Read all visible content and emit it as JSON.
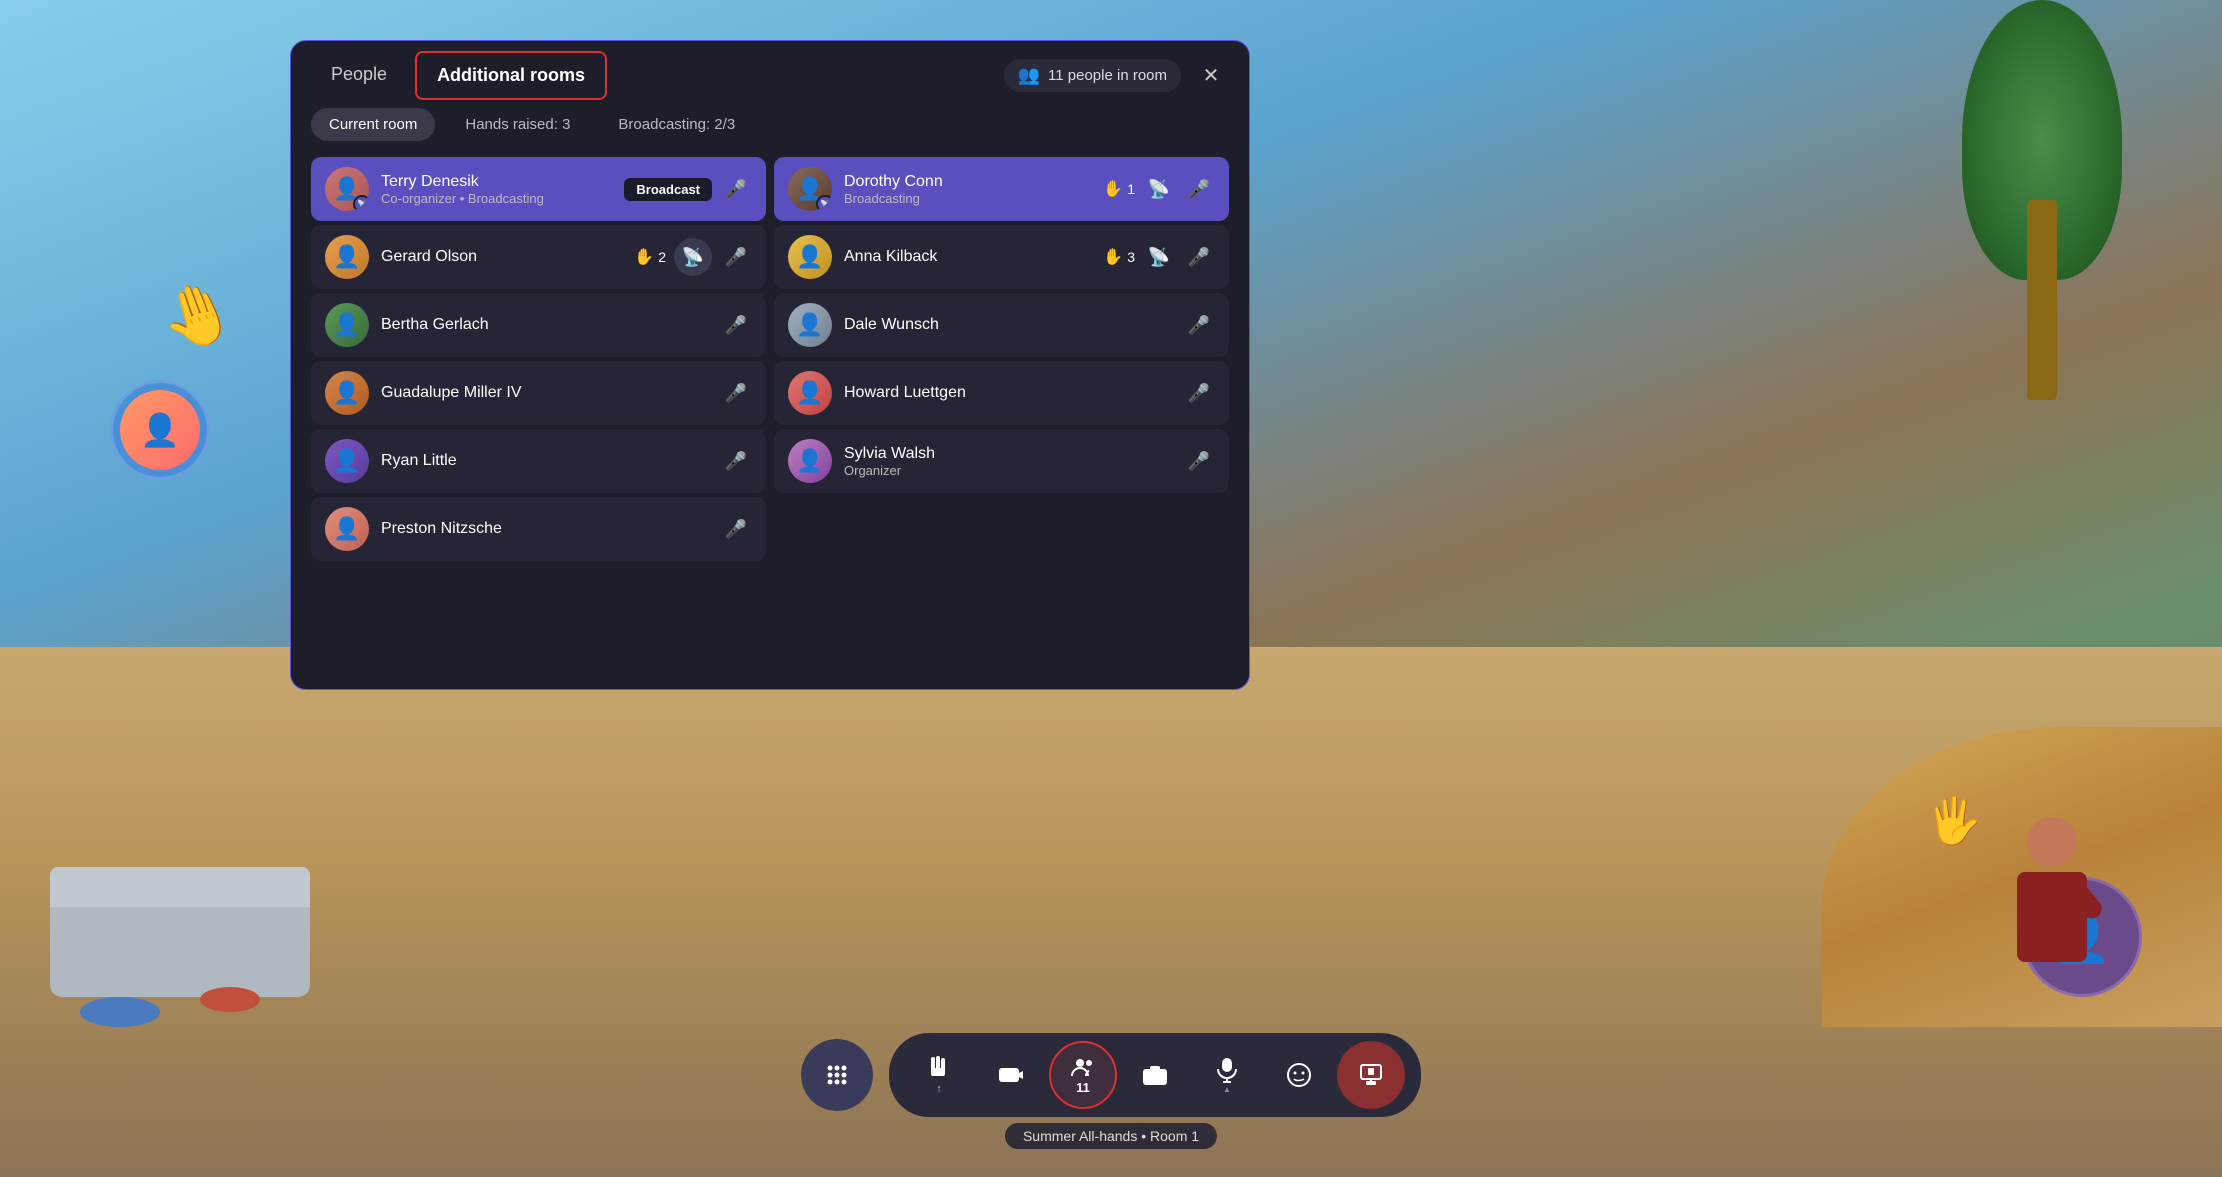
{
  "background": {
    "scene": "virtual-metaverse-room"
  },
  "panel": {
    "border_color": "#6050e0"
  },
  "tabs": {
    "people_label": "People",
    "additional_rooms_label": "Additional rooms",
    "active_tab": "additional_rooms"
  },
  "header": {
    "people_count": "11 people in room",
    "close_label": "✕"
  },
  "filters": {
    "current_room_label": "Current room",
    "hands_raised_label": "Hands raised: 3",
    "broadcasting_label": "Broadcasting: 2/3"
  },
  "left_column": {
    "people": [
      {
        "id": "terry",
        "name": "Terry Denesik",
        "role": "Co-organizer • Broadcasting",
        "broadcasting": true,
        "action": "broadcast",
        "avatar_color": "#c06060"
      },
      {
        "id": "gerard",
        "name": "Gerard Olson",
        "broadcasting": false,
        "hand_count": "2",
        "action": "cursor",
        "avatar_color": "#d4894a"
      },
      {
        "id": "bertha",
        "name": "Bertha Gerlach",
        "broadcasting": false,
        "action": "mic-off",
        "avatar_color": "#5a9a5a"
      },
      {
        "id": "guadalupe",
        "name": "Guadalupe Miller IV",
        "broadcasting": false,
        "action": "mic",
        "avatar_color": "#d4874a"
      },
      {
        "id": "ryan",
        "name": "Ryan Little",
        "broadcasting": false,
        "action": "mic",
        "avatar_color": "#7a5abf"
      },
      {
        "id": "preston",
        "name": "Preston Nitzsche",
        "broadcasting": false,
        "action": "mic",
        "avatar_color": "#e09080"
      }
    ]
  },
  "right_column": {
    "people": [
      {
        "id": "dorothy",
        "name": "Dorothy Conn",
        "role": "Broadcasting",
        "broadcasting": true,
        "hand_count": "1",
        "action": "broadcast",
        "avatar_color": "#8a6a5a"
      },
      {
        "id": "anna",
        "name": "Anna Kilback",
        "broadcasting": false,
        "hand_count": "3",
        "action": "broadcast",
        "avatar_color": "#e8c050"
      },
      {
        "id": "dale",
        "name": "Dale Wunsch",
        "broadcasting": false,
        "action": "mic-off",
        "avatar_color": "#a0b0c0"
      },
      {
        "id": "howard",
        "name": "Howard Luettgen",
        "broadcasting": false,
        "action": "mic",
        "avatar_color": "#e07870"
      },
      {
        "id": "sylvia",
        "name": "Sylvia Walsh",
        "role": "Organizer",
        "broadcasting": false,
        "action": "mic-off",
        "avatar_color": "#c080c0"
      }
    ]
  },
  "toolbar": {
    "dots_label": "⠿",
    "raise_hand_label": "⇑",
    "camera_label": "📷",
    "people_label": "11",
    "photo_label": "📸",
    "mic_label": "🎤",
    "emoji_label": "☺",
    "share_label": "⊡"
  },
  "room_label": "Summer All-hands • Room 1"
}
